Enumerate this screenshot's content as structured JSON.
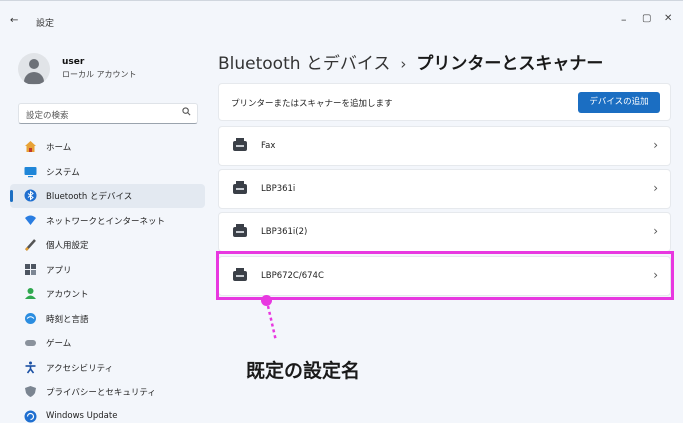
{
  "window": {
    "back_glyph": "←",
    "title": "設定",
    "minimize_glyph": "–",
    "maximize_glyph": "▢",
    "close_glyph": "✕"
  },
  "profile": {
    "username": "user",
    "account_type": "ローカル アカウント"
  },
  "search": {
    "placeholder": "設定の検索"
  },
  "sidebar": {
    "items": [
      {
        "label": "ホーム",
        "icon": "home-icon"
      },
      {
        "label": "システム",
        "icon": "system-icon"
      },
      {
        "label": "Bluetooth とデバイス",
        "icon": "bluetooth-icon",
        "active": true
      },
      {
        "label": "ネットワークとインターネット",
        "icon": "network-icon"
      },
      {
        "label": "個人用設定",
        "icon": "personalization-icon"
      },
      {
        "label": "アプリ",
        "icon": "apps-icon"
      },
      {
        "label": "アカウント",
        "icon": "accounts-icon"
      },
      {
        "label": "時刻と言語",
        "icon": "time-language-icon"
      },
      {
        "label": "ゲーム",
        "icon": "gaming-icon"
      },
      {
        "label": "アクセシビリティ",
        "icon": "accessibility-icon"
      },
      {
        "label": "プライバシーとセキュリティ",
        "icon": "privacy-icon"
      },
      {
        "label": "Windows Update",
        "icon": "windows-update-icon"
      }
    ]
  },
  "breadcrumb": {
    "parent": "Bluetooth とデバイス",
    "separator": "›",
    "current": "プリンターとスキャナー"
  },
  "add_device": {
    "text": "プリンターまたはスキャナーを追加します",
    "button_label": "デバイスの追加"
  },
  "printers": [
    {
      "name": "Fax"
    },
    {
      "name": "LBP361i"
    },
    {
      "name": "LBP361i(2)"
    },
    {
      "name": "LBP672C/674C"
    }
  ],
  "annotation": {
    "label": "既定の設定名"
  },
  "colors": {
    "accent": "#1b6ec2",
    "highlight": "#e838e0"
  }
}
